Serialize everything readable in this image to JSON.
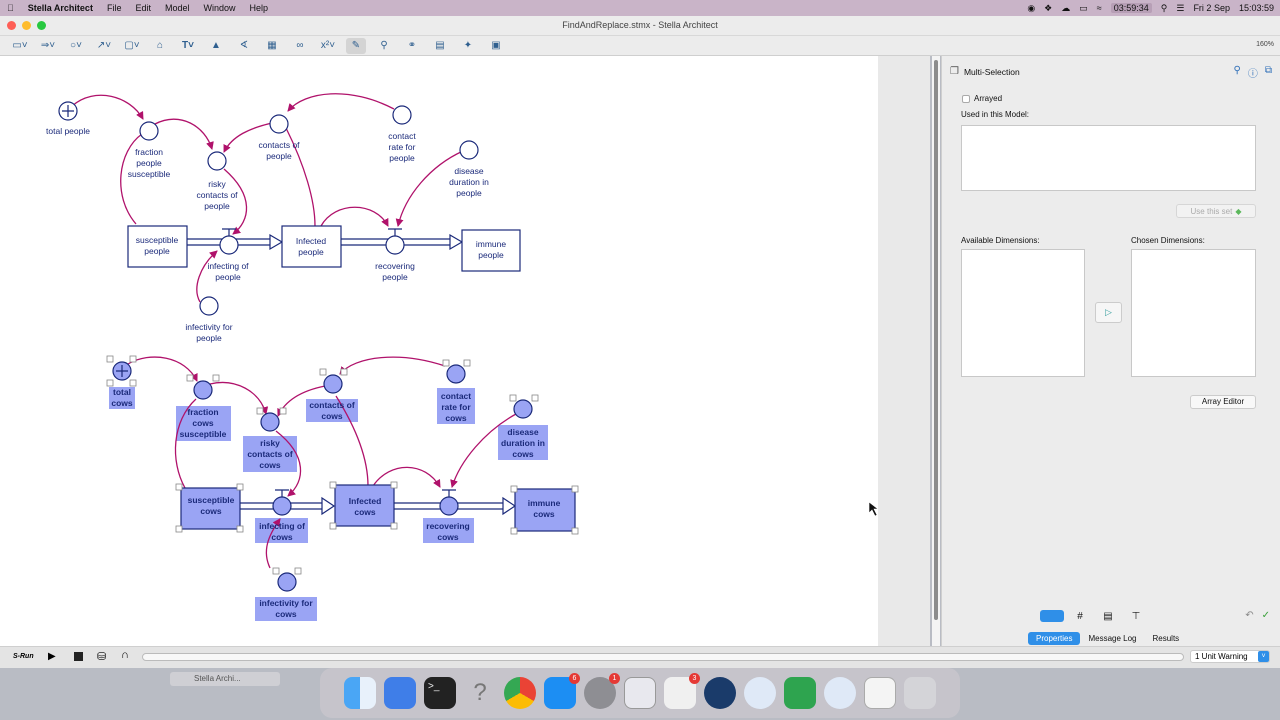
{
  "menubar": {
    "app": "Stella Architect",
    "items": [
      "File",
      "Edit",
      "Model",
      "Window",
      "Help"
    ],
    "clock1": "03:59:34",
    "date": "Fri 2 Sep",
    "time": "15:03:59"
  },
  "window": {
    "title": "FindAndReplace.stmx - Stella Architect",
    "zoom": "160%"
  },
  "model_people": {
    "total": "total people",
    "fraction": [
      "fraction",
      "people",
      "susceptible"
    ],
    "risky": [
      "risky",
      "contacts of",
      "people"
    ],
    "contacts": [
      "contacts of",
      "people"
    ],
    "contact_rate": [
      "contact",
      "rate for",
      "people"
    ],
    "duration": [
      "disease",
      "duration in",
      "people"
    ],
    "susceptible": [
      "susceptible",
      "people"
    ],
    "infecting": [
      "infecting of",
      "people"
    ],
    "infected": [
      "Infected",
      "people"
    ],
    "recovering": [
      "recovering",
      "people"
    ],
    "immune": [
      "immune",
      "people"
    ],
    "infectivity": [
      "infectivity for",
      "people"
    ]
  },
  "model_cows": {
    "total": [
      "total",
      "cows"
    ],
    "fraction": [
      "fraction",
      "cows",
      "susceptible"
    ],
    "risky": [
      "risky",
      "contacts of",
      "cows"
    ],
    "contacts": [
      "contacts of",
      "cows"
    ],
    "contact_rate": [
      "contact",
      "rate for",
      "cows"
    ],
    "duration": [
      "disease",
      "duration in",
      "cows"
    ],
    "susceptible": [
      "susceptible",
      "cows"
    ],
    "infecting": [
      "infecting of",
      "cows"
    ],
    "infected": [
      "Infected",
      "cows"
    ],
    "recovering": [
      "recovering",
      "cows"
    ],
    "immune": [
      "immune",
      "cows"
    ],
    "infectivity": [
      "infectivity for",
      "cows"
    ]
  },
  "panel": {
    "title": "Multi-Selection",
    "arrayed": "Arrayed",
    "used_label": "Used in this Model:",
    "use_set": "Use this set",
    "available": "Available Dimensions:",
    "chosen": "Chosen Dimensions:",
    "array_editor": "Array Editor",
    "tabs": [
      "Properties",
      "Message Log",
      "Results"
    ],
    "active_tab": "Properties"
  },
  "bottombar": {
    "run": "S-Run",
    "warning": "1 Unit Warning",
    "thumb": "Stella Archi..."
  },
  "dock": {
    "badges": [
      "6",
      "1",
      "3"
    ]
  },
  "colors": {
    "node_stroke": "#1b2a7a",
    "connector": "#b0126b",
    "selection": "#9aa4f4",
    "accent": "#2f8fe8"
  }
}
